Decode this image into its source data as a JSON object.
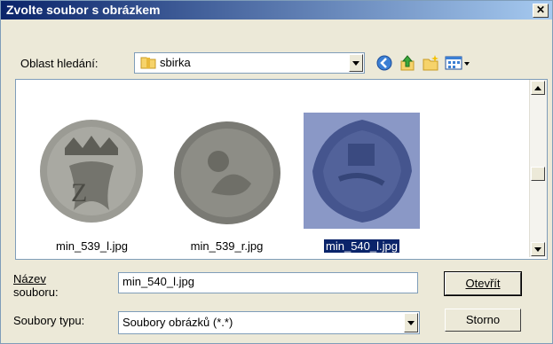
{
  "dialog": {
    "title": "Zvolte soubor s obrázkem",
    "close_glyph": "✕"
  },
  "lookin": {
    "label": "Oblast hledání:",
    "value": "sbirka"
  },
  "toolbar": {
    "icons": [
      "back-icon",
      "up-folder-icon",
      "new-folder-icon",
      "view-menu-icon"
    ]
  },
  "files": [
    {
      "name": "min_539_l.jpg",
      "selected": false
    },
    {
      "name": "min_539_r.jpg",
      "selected": false
    },
    {
      "name": "min_540_l.jpg",
      "selected": true
    }
  ],
  "filename": {
    "label_line1": "Název",
    "label_line2": "souboru:",
    "value": "min_540_l.jpg"
  },
  "filetype": {
    "label": "Soubory typu:",
    "value": "Soubory obrázků (*.*)"
  },
  "buttons": {
    "open": "Otevřít",
    "cancel": "Storno"
  },
  "colors": {
    "title_start": "#0a246a",
    "title_end": "#a6caf0",
    "selection": "#0a246a"
  }
}
